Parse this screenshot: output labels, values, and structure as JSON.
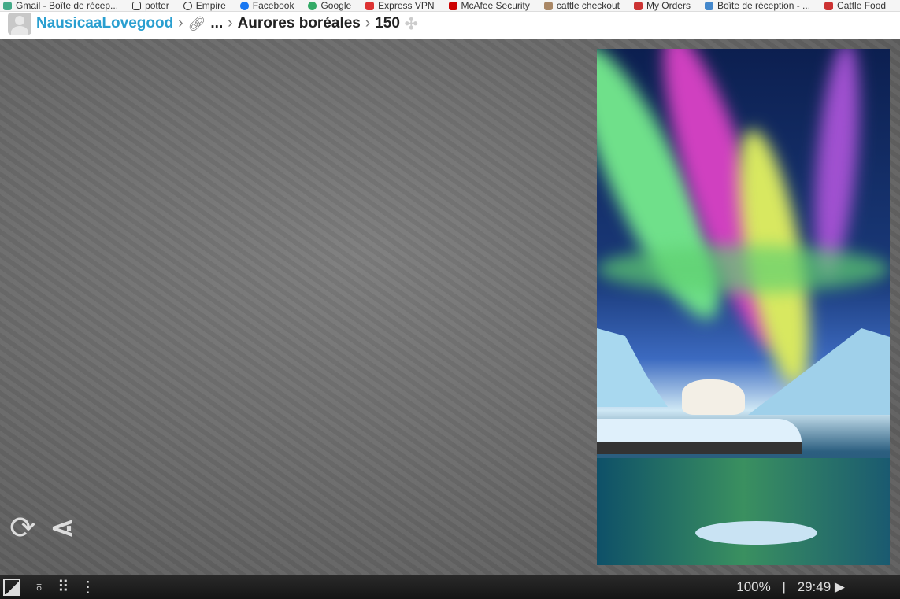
{
  "bookmarks": [
    "Gmail - Boîte de récep...",
    "potter",
    "Empire",
    "Facebook",
    "Google",
    "Express VPN",
    "McAfee Security",
    "cattle checkout",
    "My Orders",
    "Boîte de réception - ...",
    "Cattle Food"
  ],
  "breadcrumb": {
    "user": "NausicaaLovegood",
    "ellipsis": "...",
    "collection": "Aurores boréales",
    "pieces": "150"
  },
  "status": {
    "zoom": "100%",
    "divider": "|",
    "timer": "29:49"
  },
  "colors": {
    "user_link": "#2a9fd0",
    "bar": "#1c1c1c"
  }
}
